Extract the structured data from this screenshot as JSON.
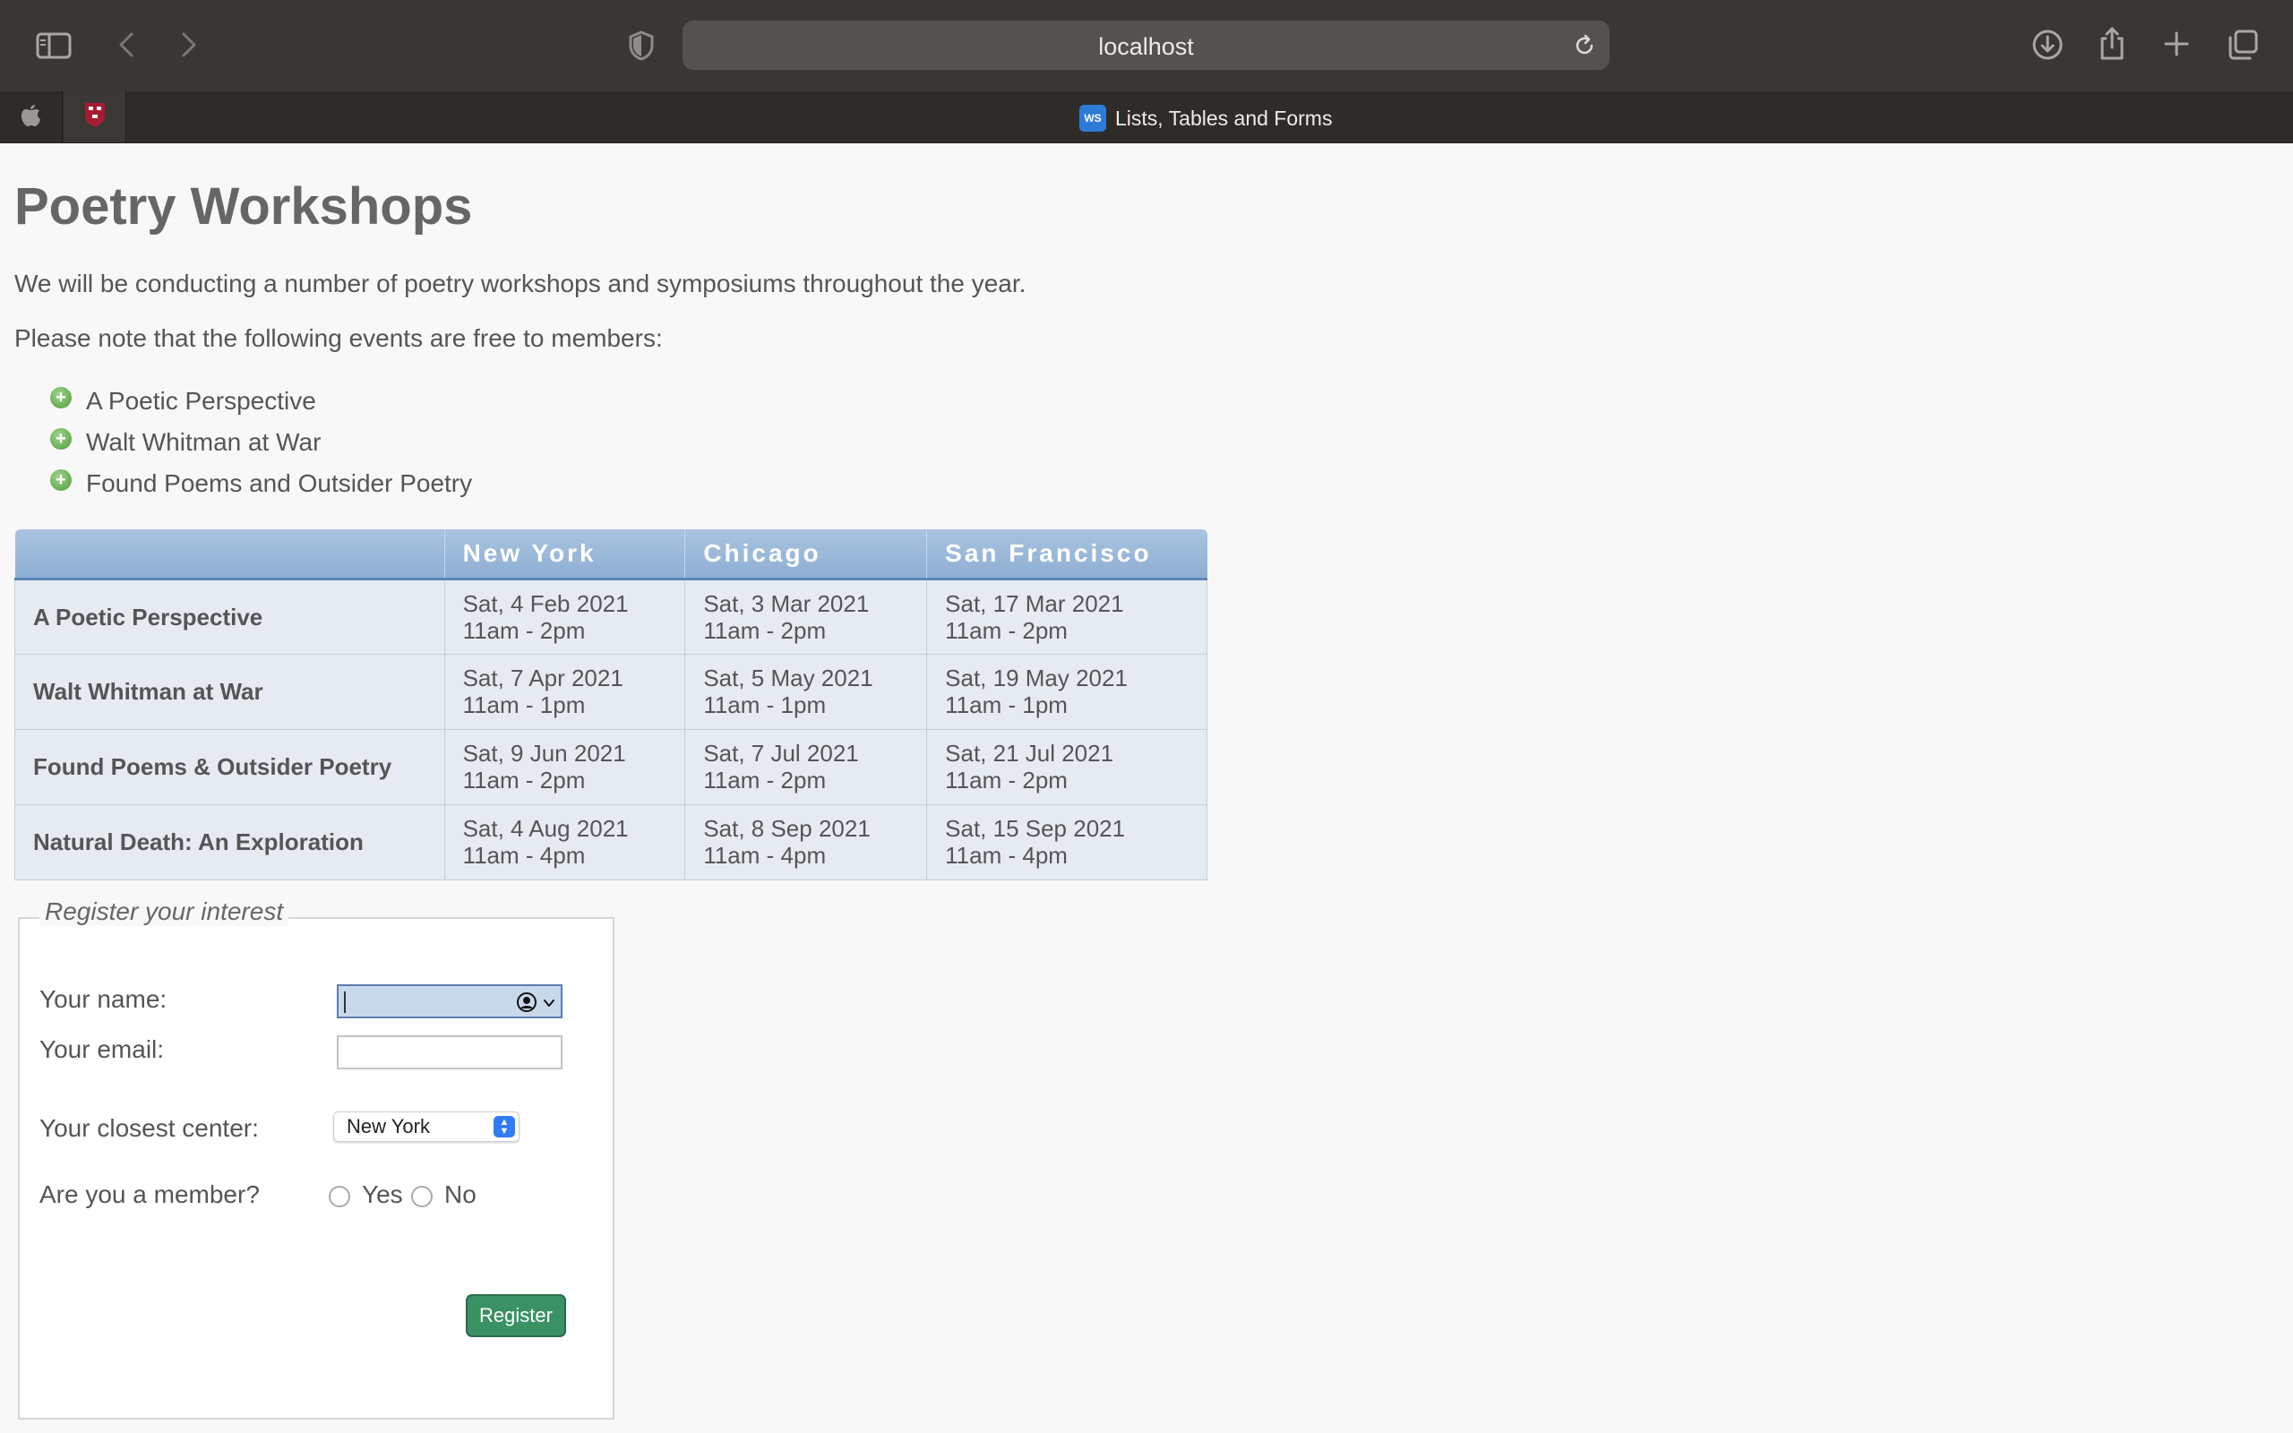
{
  "browser": {
    "url": "localhost",
    "active_tab_title": "Lists, Tables and Forms",
    "favicon_text": "WS",
    "icons": [
      "sidebar-icon",
      "back-icon",
      "forward-icon",
      "privacy-shield-icon",
      "reload-icon",
      "download-icon",
      "share-icon",
      "new-tab-icon",
      "tab-overview-icon",
      "apple-icon",
      "harvard-shield-icon"
    ]
  },
  "page": {
    "title": "Poetry Workshops",
    "intro": "We will be conducting a number of poetry workshops and symposiums throughout the year.",
    "note": "Please note that the following events are free to members:",
    "free_events": [
      "A Poetic Perspective",
      "Walt Whitman at War",
      "Found Poems and Outsider Poetry"
    ]
  },
  "schedule": {
    "headers": [
      "",
      "New York",
      "Chicago",
      "San Francisco"
    ],
    "rows": [
      {
        "event": "A Poetic Perspective",
        "cells": [
          [
            "Sat, 4 Feb 2021",
            "11am - 2pm"
          ],
          [
            "Sat, 3 Mar 2021",
            "11am - 2pm"
          ],
          [
            "Sat, 17 Mar 2021",
            "11am - 2pm"
          ]
        ]
      },
      {
        "event": "Walt Whitman at War",
        "cells": [
          [
            "Sat, 7 Apr 2021",
            "11am - 1pm"
          ],
          [
            "Sat, 5 May 2021",
            "11am - 1pm"
          ],
          [
            "Sat, 19 May 2021",
            "11am - 1pm"
          ]
        ]
      },
      {
        "event": "Found Poems & Outsider Poetry",
        "cells": [
          [
            "Sat, 9 Jun 2021",
            "11am - 2pm"
          ],
          [
            "Sat, 7 Jul 2021",
            "11am - 2pm"
          ],
          [
            "Sat, 21 Jul 2021",
            "11am - 2pm"
          ]
        ]
      },
      {
        "event": "Natural Death: An Exploration",
        "cells": [
          [
            "Sat, 4 Aug 2021",
            "11am - 4pm"
          ],
          [
            "Sat, 8 Sep 2021",
            "11am - 4pm"
          ],
          [
            "Sat, 15 Sep 2021",
            "11am - 4pm"
          ]
        ]
      }
    ]
  },
  "form": {
    "legend": "Register your interest",
    "name_label": "Your name:",
    "name_value": "",
    "email_label": "Your email:",
    "email_value": "",
    "center_label": "Your closest center:",
    "center_selected": "New York",
    "member_label": "Are you a member?",
    "member_options": [
      "Yes",
      "No"
    ],
    "submit_label": "Register"
  },
  "colors": {
    "chrome_bg": "#3a3634",
    "table_header": "#8eafd4",
    "table_cell": "#e6ebf2",
    "register_button": "#3a9163",
    "select_accent": "#2f7cf6"
  }
}
